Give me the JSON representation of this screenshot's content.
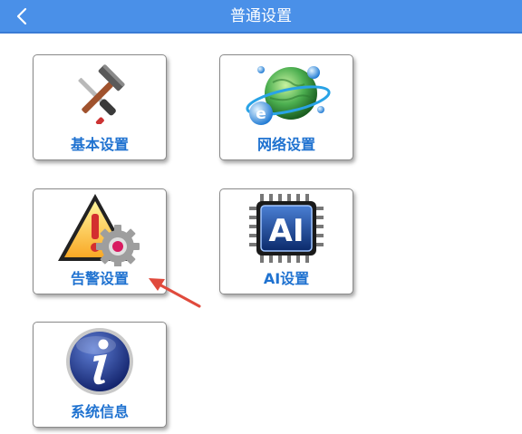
{
  "header": {
    "title": "普通设置",
    "back_icon": "chevron-left-icon",
    "color": "#4a90e8"
  },
  "tiles": [
    {
      "label": "基本设置",
      "icon": "tools-icon"
    },
    {
      "label": "网络设置",
      "icon": "globe-internet-icon"
    },
    {
      "label": "告警设置",
      "icon": "warning-gear-icon"
    },
    {
      "label": "AI设置",
      "icon": "ai-chip-icon"
    },
    {
      "label": "系统信息",
      "icon": "info-icon"
    }
  ],
  "colors": {
    "label": "#1f72d0",
    "annotation_arrow": "#e04a3c"
  }
}
